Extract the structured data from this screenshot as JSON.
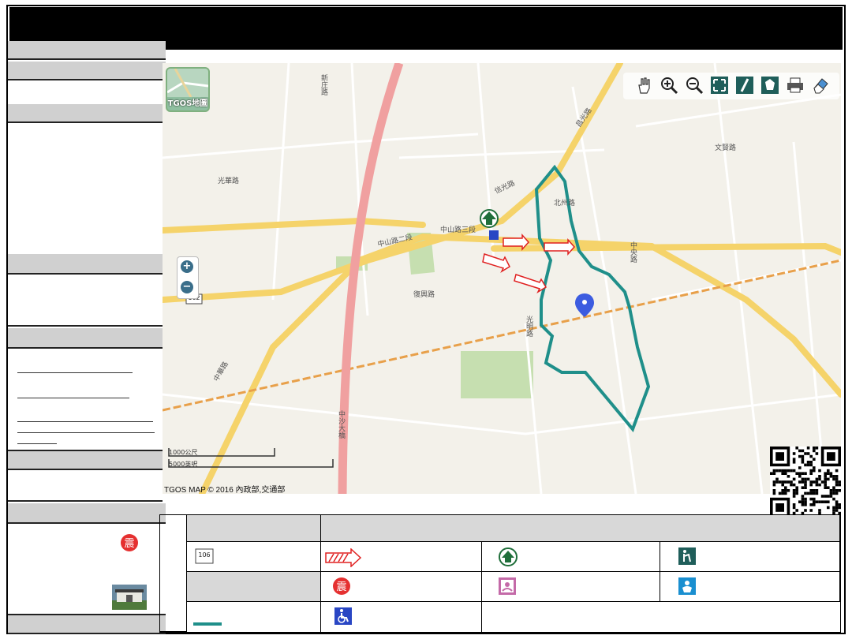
{
  "map": {
    "attribution": "TGOS MAP © 2016 內政部,交通部",
    "tgos_button_label": "TGOS地圖",
    "scale_metric": "1000公尺",
    "scale_imperial": "5000英呎",
    "road_badge": "162",
    "road_labels": [
      {
        "text": "新庄路"
      },
      {
        "text": "光華路"
      },
      {
        "text": "中山路二段"
      },
      {
        "text": "中山路三段"
      },
      {
        "text": "信光路"
      },
      {
        "text": "昌光路"
      },
      {
        "text": "北州路"
      },
      {
        "text": "中沙大橋"
      },
      {
        "text": "中華路"
      },
      {
        "text": "復興路"
      },
      {
        "text": "中央路"
      },
      {
        "text": "光明路"
      },
      {
        "text": "文賢路"
      }
    ],
    "colors": {
      "boundary": "#1f8f8a",
      "highway": "#f0a0a0",
      "major_road": "#f5d36a",
      "railway": "#e8a04a",
      "green": "#c6dfb0",
      "marker": "#3c5ce0"
    }
  },
  "toolbar": {
    "tools": [
      "pan-icon",
      "zoom-in-icon",
      "zoom-out-icon",
      "full-extent-icon",
      "measure-icon",
      "area-icon",
      "print-icon",
      "eraser-icon"
    ]
  },
  "legend": {
    "rows": [
      {
        "icon": "road-number-icon",
        "badge": "106",
        "items": [
          "evacuation-arrow-icon",
          "shelter-icon",
          "elderly-care-icon"
        ]
      },
      {
        "items": [
          "earthquake-icon",
          "nursing-room-icon",
          "baby-care-icon"
        ]
      },
      {
        "icon": "boundary-line-icon",
        "items": [
          "wheelchair-icon"
        ]
      }
    ]
  }
}
